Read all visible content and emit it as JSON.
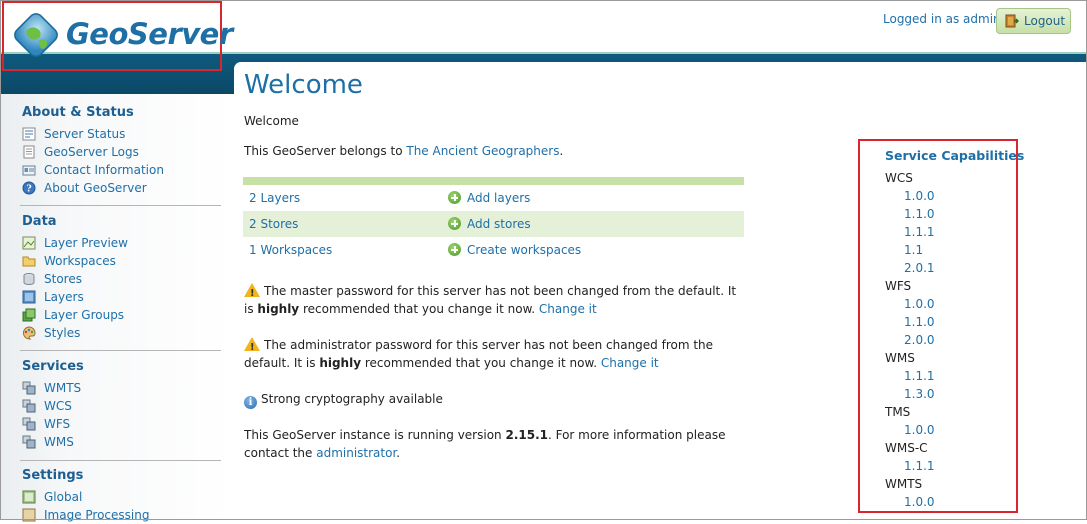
{
  "header": {
    "logo_text": "GeoServer",
    "login_text": "Logged in as admin.",
    "logout_label": "Logout"
  },
  "sidebar": {
    "about": {
      "title": "About & Status",
      "items": [
        {
          "label": "Server Status",
          "icon": "server-status-icon"
        },
        {
          "label": "GeoServer Logs",
          "icon": "logs-icon"
        },
        {
          "label": "Contact Information",
          "icon": "contact-card-icon"
        },
        {
          "label": "About GeoServer",
          "icon": "about-icon"
        }
      ]
    },
    "data": {
      "title": "Data",
      "items": [
        {
          "label": "Layer Preview",
          "icon": "layer-preview-icon"
        },
        {
          "label": "Workspaces",
          "icon": "folder-icon"
        },
        {
          "label": "Stores",
          "icon": "store-icon"
        },
        {
          "label": "Layers",
          "icon": "layers-icon"
        },
        {
          "label": "Layer Groups",
          "icon": "layer-groups-icon"
        },
        {
          "label": "Styles",
          "icon": "palette-icon"
        }
      ]
    },
    "services": {
      "title": "Services",
      "items": [
        {
          "label": "WMTS",
          "icon": "service-icon"
        },
        {
          "label": "WCS",
          "icon": "service-icon"
        },
        {
          "label": "WFS",
          "icon": "service-icon"
        },
        {
          "label": "WMS",
          "icon": "service-icon"
        }
      ]
    },
    "settings": {
      "title": "Settings",
      "items": [
        {
          "label": "Global",
          "icon": "globe-icon"
        },
        {
          "label": "Image Processing",
          "icon": "image-processing-icon"
        }
      ]
    }
  },
  "main": {
    "title": "Welcome",
    "subtitle": "Welcome",
    "belongs_prefix": "This GeoServer belongs to ",
    "belongs_link": "The Ancient Geographers",
    "belongs_suffix": ".",
    "stats": [
      {
        "count": "2 Layers",
        "action": "Add layers"
      },
      {
        "count": "2 Stores",
        "action": "Add stores"
      },
      {
        "count": "1 Workspaces",
        "action": "Create workspaces"
      }
    ],
    "warning1": {
      "pre": "The master password for this server has not been changed from the default. It is ",
      "bold": "highly",
      "post": " recommended that you change it now. ",
      "link": "Change it"
    },
    "warning2": {
      "pre": "The administrator password for this server has not been changed from the default. It is ",
      "bold": "highly",
      "post": " recommended that you change it now. ",
      "link": "Change it"
    },
    "crypto": "Strong cryptography available",
    "version": {
      "pre": "This GeoServer instance is running version ",
      "number": "2.15.1",
      "mid": ". For more information please contact the ",
      "link": "administrator",
      "post": "."
    }
  },
  "capabilities": {
    "title": "Service Capabilities",
    "services": [
      {
        "name": "WCS",
        "versions": [
          "1.0.0",
          "1.1.0",
          "1.1.1",
          "1.1",
          "2.0.1"
        ]
      },
      {
        "name": "WFS",
        "versions": [
          "1.0.0",
          "1.1.0",
          "2.0.0"
        ]
      },
      {
        "name": "WMS",
        "versions": [
          "1.1.1",
          "1.3.0"
        ]
      },
      {
        "name": "TMS",
        "versions": [
          "1.0.0"
        ]
      },
      {
        "name": "WMS-C",
        "versions": [
          "1.1.1"
        ]
      },
      {
        "name": "WMTS",
        "versions": [
          "1.0.0"
        ]
      }
    ]
  },
  "colors": {
    "brand_blue": "#1d6fa5",
    "header_bar": "#0e5a7f",
    "highlight_border": "#d8262f",
    "table_green": "#c6e0a6"
  }
}
